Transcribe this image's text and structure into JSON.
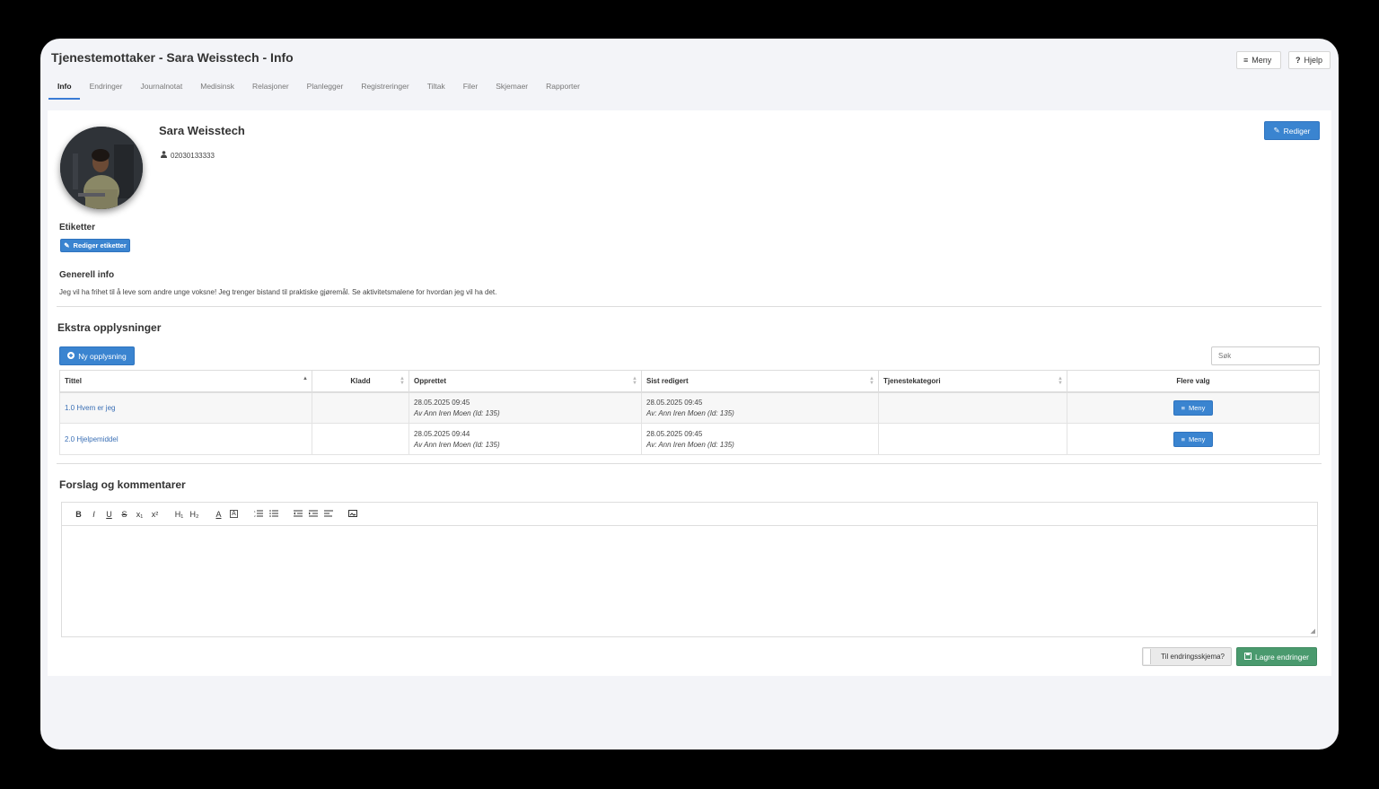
{
  "header": {
    "title": "Tjenestemottaker - Sara Weisstech - Info",
    "menu_label": "Meny",
    "help_label": "Hjelp"
  },
  "tabs": [
    "Info",
    "Endringer",
    "Journalnotat",
    "Medisinsk",
    "Relasjoner",
    "Planlegger",
    "Registreringer",
    "Tiltak",
    "Filer",
    "Skjemaer",
    "Rapporter"
  ],
  "active_tab": "Info",
  "profile": {
    "name": "Sara Weisstech",
    "id_number": "02030133333",
    "edit_label": "Rediger"
  },
  "labels": {
    "heading": "Etiketter",
    "edit_labels": "Rediger etiketter"
  },
  "general": {
    "heading": "Generell info",
    "text": "Jeg vil ha frihet til å leve som andre unge voksne! Jeg trenger bistand til praktiske gjøremål. Se aktivitetsmalene for hvordan jeg vil ha det."
  },
  "extra": {
    "heading": "Ekstra opplysninger",
    "new_label": "Ny opplysning",
    "search_placeholder": "Søk",
    "columns": [
      "Tittel",
      "Kladd",
      "Opprettet",
      "Sist redigert",
      "Tjenestekategori",
      "Flere valg"
    ],
    "rows": [
      {
        "title": "1.0 Hvem er jeg",
        "draft": "",
        "created_date": "28.05.2025 09:45",
        "created_by": "Av Ann Iren Moen (Id: 135)",
        "edited_date": "28.05.2025 09:45",
        "edited_by": "Av: Ann Iren Moen (Id: 135)",
        "category": "",
        "menu_label": "Meny"
      },
      {
        "title": "2.0 Hjelpemiddel",
        "draft": "",
        "created_date": "28.05.2025 09:44",
        "created_by": "Av Ann Iren Moen (Id: 135)",
        "edited_date": "28.05.2025 09:45",
        "edited_by": "Av: Ann Iren Moen (Id: 135)",
        "category": "",
        "menu_label": "Meny"
      }
    ]
  },
  "comments": {
    "heading": "Forslag og kommentarer",
    "toolbar": [
      "B",
      "I",
      "U",
      "S",
      "x₁",
      "x²",
      "H₁",
      "H₂",
      "A",
      "A",
      "ordered-list",
      "bullet-list",
      "outdent",
      "indent",
      "align",
      "image"
    ]
  },
  "footer": {
    "toggle_label": "Til endringsskjema?",
    "save_label": "Lagre endringer"
  },
  "colors": {
    "primary": "#3a84d0",
    "success": "#4a9a6e",
    "tab_underline": "#3a7bd5"
  }
}
